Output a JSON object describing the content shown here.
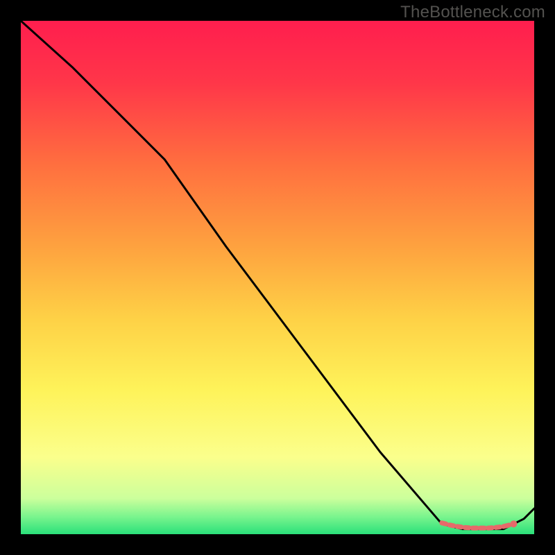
{
  "watermark": "TheBottleneck.com",
  "colors": {
    "background": "#000000",
    "watermark_text": "#53524f",
    "line": "#000000",
    "marker": "#E66A6A",
    "gradient_stops": [
      {
        "offset": 0.0,
        "color": "#FF1E4E"
      },
      {
        "offset": 0.12,
        "color": "#FF3649"
      },
      {
        "offset": 0.28,
        "color": "#FF6F3F"
      },
      {
        "offset": 0.44,
        "color": "#FEA23F"
      },
      {
        "offset": 0.58,
        "color": "#FED146"
      },
      {
        "offset": 0.72,
        "color": "#FEF35A"
      },
      {
        "offset": 0.85,
        "color": "#FBFF8C"
      },
      {
        "offset": 0.93,
        "color": "#CCFF9C"
      },
      {
        "offset": 0.965,
        "color": "#7CF58E"
      },
      {
        "offset": 1.0,
        "color": "#2AE07A"
      }
    ]
  },
  "chart_data": {
    "type": "line",
    "title": "",
    "xlabel": "",
    "ylabel": "",
    "xlim": [
      0,
      100
    ],
    "ylim": [
      0,
      100
    ],
    "grid": false,
    "legend": false,
    "series": [
      {
        "name": "curve",
        "x": [
          0,
          10,
          20,
          28,
          40,
          55,
          70,
          82,
          86,
          88,
          90,
          92,
          94,
          96,
          98,
          100
        ],
        "y": [
          100,
          91,
          81,
          73,
          56,
          36,
          16,
          2,
          1,
          1,
          1,
          1,
          1,
          2,
          3,
          5
        ]
      }
    ],
    "bottom_markers": {
      "comment": "small dashed/dotted pink segment near the valley floor",
      "x": [
        82,
        83.5,
        85,
        86.5,
        88,
        89.5,
        91,
        92.5,
        94,
        96
      ],
      "y": [
        2.2,
        1.8,
        1.5,
        1.3,
        1.2,
        1.2,
        1.2,
        1.3,
        1.5,
        2.0
      ]
    }
  }
}
